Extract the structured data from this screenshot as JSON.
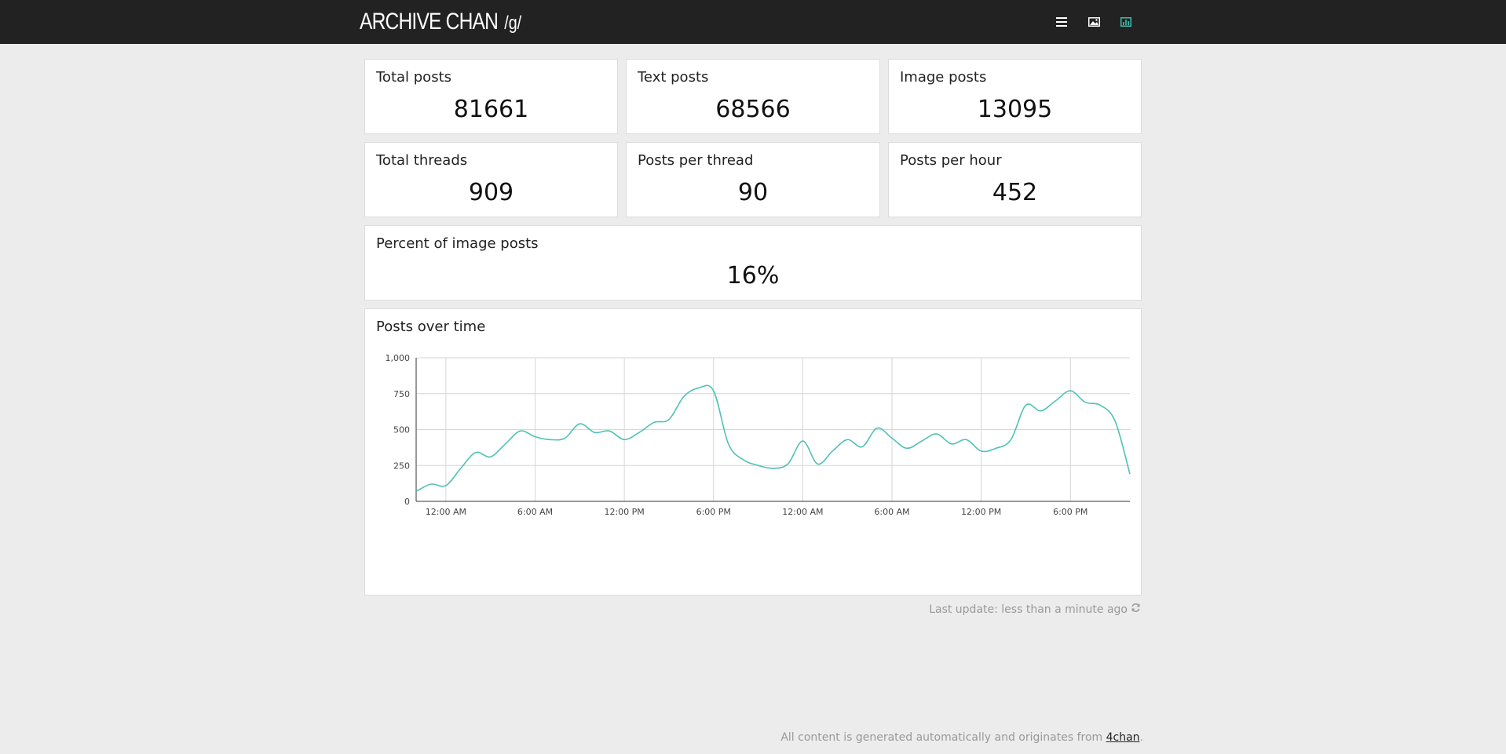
{
  "header": {
    "brand": "ARCHIVE CHAN",
    "board": "/g/",
    "icons": [
      {
        "name": "list-icon",
        "color": "#ffffff"
      },
      {
        "name": "image-icon",
        "color": "#ffffff"
      },
      {
        "name": "bar-chart-icon",
        "color": "#3fbfb0",
        "active": true
      }
    ]
  },
  "stats": {
    "total_posts": {
      "label": "Total posts",
      "value": "81661"
    },
    "text_posts": {
      "label": "Text posts",
      "value": "68566"
    },
    "image_posts": {
      "label": "Image posts",
      "value": "13095"
    },
    "total_threads": {
      "label": "Total threads",
      "value": "909"
    },
    "posts_per_thread": {
      "label": "Posts per thread",
      "value": "90"
    },
    "posts_per_hour": {
      "label": "Posts per hour",
      "value": "452"
    },
    "percent_image": {
      "label": "Percent of image posts",
      "value": "16%"
    }
  },
  "chart_card": {
    "title": "Posts over time"
  },
  "chart_data": {
    "type": "line",
    "title": "Posts over time",
    "color": "#4fc2b4",
    "ylim": [
      0,
      1000
    ],
    "yticks": [
      "0",
      "250",
      "500",
      "750",
      "1,000"
    ],
    "ytick_values": [
      0,
      250,
      500,
      750,
      1000
    ],
    "xlim": [
      -2,
      46
    ],
    "xticks": [
      {
        "label": "12:00 AM",
        "hour": 0
      },
      {
        "label": "6:00 AM",
        "hour": 6
      },
      {
        "label": "12:00 PM",
        "hour": 12
      },
      {
        "label": "6:00 PM",
        "hour": 18
      },
      {
        "label": "12:00 AM",
        "hour": 24
      },
      {
        "label": "6:00 AM",
        "hour": 30
      },
      {
        "label": "12:00 PM",
        "hour": 36
      },
      {
        "label": "6:00 PM",
        "hour": 42
      }
    ],
    "grid": true,
    "series": [
      {
        "x": [
          -2,
          -1,
          0,
          1,
          2,
          3,
          4,
          5,
          6,
          7,
          8,
          9,
          10,
          11,
          12,
          13,
          14,
          15,
          16,
          17,
          18,
          19,
          20,
          21,
          22,
          23,
          24,
          25,
          26,
          27,
          28,
          29,
          30,
          31,
          32,
          33,
          34,
          35,
          36,
          37,
          38,
          39,
          40,
          41,
          42,
          43,
          44,
          45,
          46
        ],
        "values": [
          70,
          120,
          110,
          230,
          340,
          310,
          400,
          490,
          450,
          430,
          440,
          540,
          480,
          490,
          430,
          480,
          550,
          570,
          730,
          790,
          770,
          400,
          290,
          250,
          230,
          260,
          420,
          260,
          350,
          430,
          380,
          510,
          440,
          370,
          420,
          470,
          400,
          430,
          350,
          370,
          430,
          670,
          630,
          700,
          770,
          690,
          670,
          560,
          190
        ]
      }
    ]
  },
  "footer": {
    "last_update": "Last update: less than a minute ago",
    "note_prefix": "All content is generated automatically and originates from ",
    "note_link": "4chan",
    "note_suffix": "."
  }
}
